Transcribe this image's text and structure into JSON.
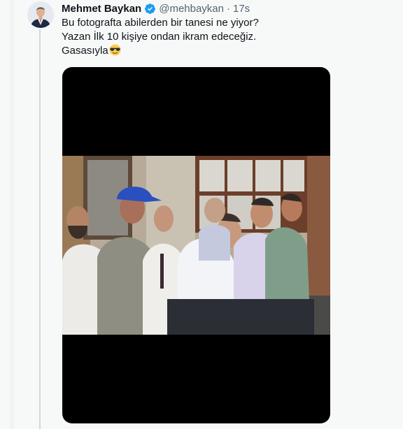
{
  "tweet": {
    "author_name": "Mehmet Baykan",
    "handle": "@mehbaykan",
    "separator": "·",
    "time": "17s",
    "verified": true,
    "text_lines": [
      "Bu fotografta abilerden bir tanesi ne yiyor?",
      "Yazan İlk 10 kişiye ondan ikram edeceğiz.",
      "Gasasıyla"
    ],
    "emoji": "smiling-face-with-sunglasses-icon"
  },
  "colors": {
    "verified_blue": "#1d9bf0",
    "secondary_text": "#536471",
    "primary_text": "#0f1419",
    "background": "#f7f9f9"
  }
}
